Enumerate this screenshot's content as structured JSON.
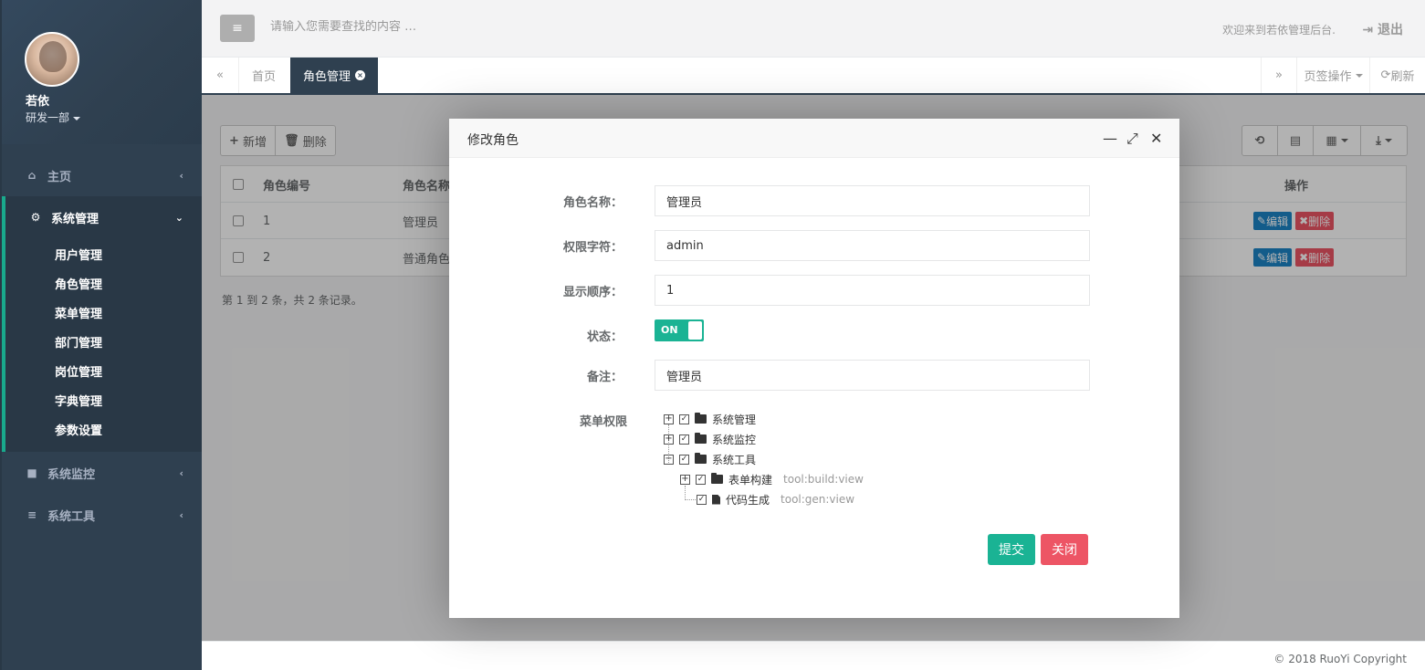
{
  "profile": {
    "name": "若依",
    "dept": "研发一部"
  },
  "sidebar": {
    "items": [
      {
        "label": "主页",
        "icon": "home-icon"
      },
      {
        "label": "系统管理",
        "icon": "gear-icon"
      },
      {
        "label": "系统监控",
        "icon": "video-camera-icon"
      },
      {
        "label": "系统工具",
        "icon": "bars-icon"
      }
    ],
    "submenu": [
      "用户管理",
      "角色管理",
      "菜单管理",
      "部门管理",
      "岗位管理",
      "字典管理",
      "参数设置"
    ]
  },
  "topbar": {
    "search_placeholder": "请输入您需要查找的内容 …",
    "welcome": "欢迎来到若依管理后台.",
    "logout": "退出"
  },
  "tabs": {
    "home": "首页",
    "active": "角色管理",
    "tab_ops": "页签操作",
    "refresh": "刷新"
  },
  "toolbar": {
    "add": "新增",
    "delete": "删除"
  },
  "table": {
    "headers": [
      "角色编号",
      "角色名称",
      "操作"
    ],
    "rows": [
      {
        "id": "1",
        "name": "管理员"
      },
      {
        "id": "2",
        "name": "普通角色"
      }
    ],
    "edit_label": "编辑",
    "delete_label": "删除",
    "pageinfo": "第 1 到 2 条，共 2 条记录。"
  },
  "footer": {
    "copyright": "© 2018 RuoYi Copyright"
  },
  "modal": {
    "title": "修改角色",
    "labels": {
      "role_name": "角色名称：",
      "role_key": "权限字符：",
      "sort": "显示顺序：",
      "status": "状态：",
      "remark": "备注：",
      "menu": "菜单权限"
    },
    "values": {
      "role_name": "管理员",
      "role_key": "admin",
      "sort": "1",
      "status": "ON",
      "remark": "管理员"
    },
    "tree": [
      {
        "label": "系统管理"
      },
      {
        "label": "系统监控"
      },
      {
        "label": "系统工具"
      },
      {
        "label": "表单构建",
        "perm": "tool:build:view"
      },
      {
        "label": "代码生成",
        "perm": "tool:gen:view"
      }
    ],
    "submit": "提交",
    "close": "关闭"
  },
  "colors": {
    "sidebar": "#2f4050",
    "accent": "#1ab394",
    "danger": "#ed5565",
    "info": "#1c84c6"
  }
}
